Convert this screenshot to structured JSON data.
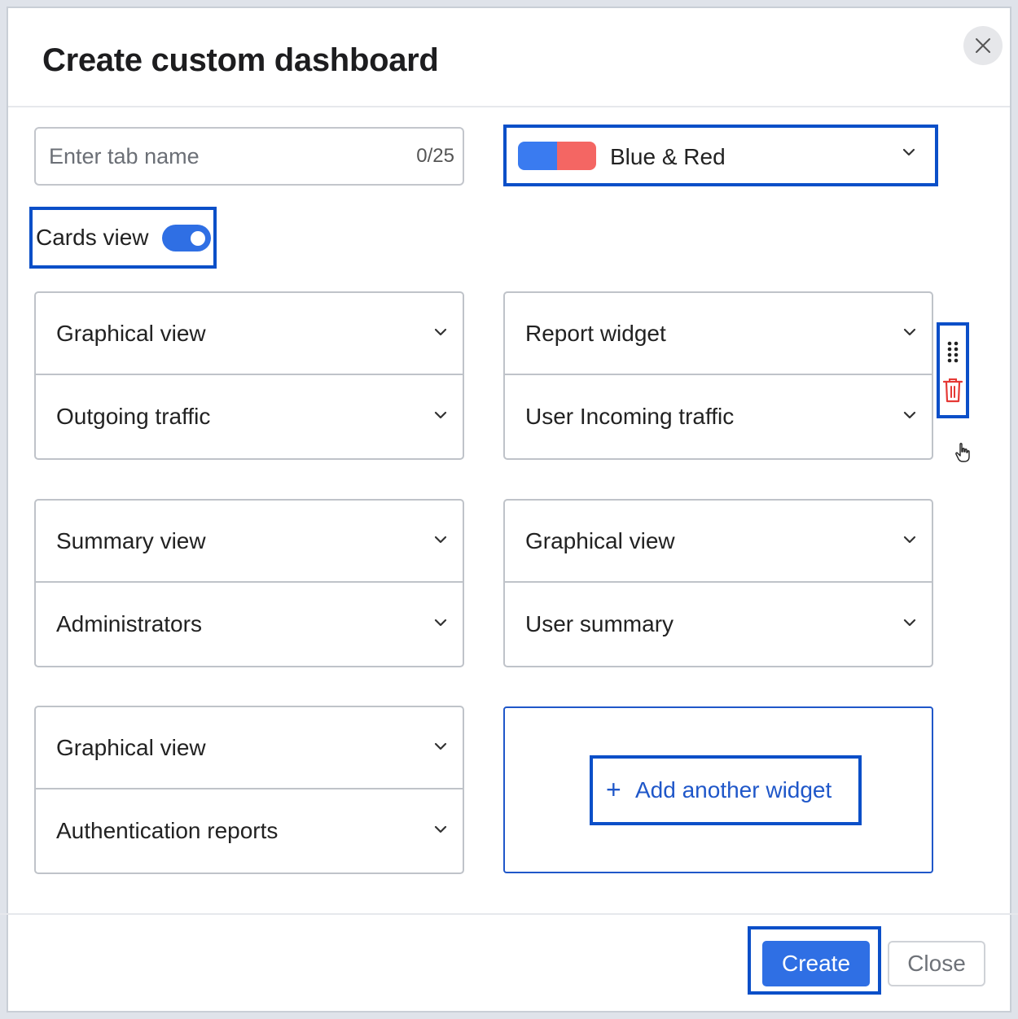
{
  "dialog": {
    "title": "Create custom dashboard",
    "close_icon": "close-icon"
  },
  "tab_name": {
    "placeholder": "Enter tab name",
    "value": "",
    "char_count": "0/25"
  },
  "theme": {
    "selected": "Blue & Red",
    "colors": {
      "primary": "#3a7bf0",
      "secondary": "#f46663"
    }
  },
  "cards_view": {
    "label": "Cards view",
    "enabled": true,
    "color": "#2f6fe4"
  },
  "widgets": [
    {
      "view": "Graphical view",
      "source": "Outgoing traffic"
    },
    {
      "view": "Report widget",
      "source": "User Incoming traffic"
    },
    {
      "view": "Summary view",
      "source": "Administrators"
    },
    {
      "view": "Graphical view",
      "source": "User summary"
    },
    {
      "view": "Graphical view",
      "source": "Authentication reports"
    }
  ],
  "row_tools": {
    "drag_icon": "drag-handle-icon",
    "delete_icon": "trash-icon",
    "delete_color": "#e53935"
  },
  "add_widget": {
    "plus": "+",
    "label": "Add another widget",
    "color": "#1f57c9"
  },
  "footer": {
    "create_label": "Create",
    "close_label": "Close",
    "create_color": "#2f6fe4"
  }
}
